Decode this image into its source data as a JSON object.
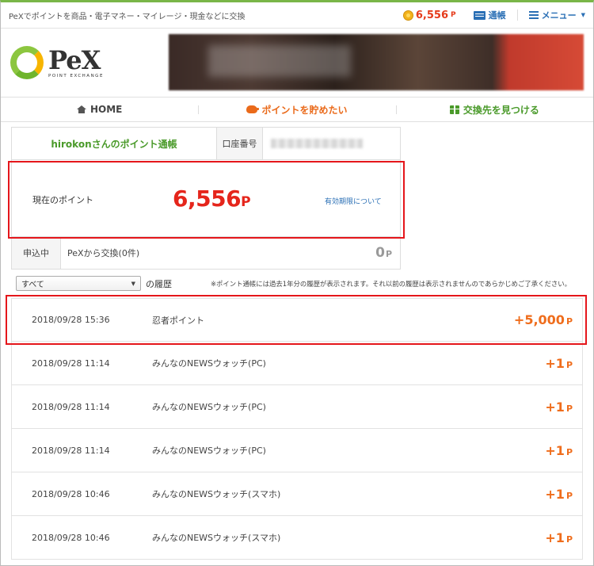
{
  "topbar": {
    "tagline": "PeXでポイントを商品・電子マネー・マイレージ・現金などに交換",
    "points": "6,556",
    "points_unit": "P",
    "passbook_link": "通帳",
    "menu_link": "メニュー"
  },
  "logo": {
    "main": "PeX",
    "sub": "POINT EXCHANGE"
  },
  "nav": {
    "home": "HOME",
    "save": "ポイントを貯めたい",
    "exchange": "交換先を見つける"
  },
  "passbook": {
    "owner": "hirokonさんのポイント通帳",
    "account_label": "口座番号",
    "current_label": "現在のポイント",
    "current_value": "6,556",
    "current_unit": "P",
    "expiry_link": "有効期限について",
    "pending_label": "申込中",
    "pending_desc": "PeXから交換(0件)",
    "pending_value": "0",
    "pending_unit": "P"
  },
  "filter": {
    "selected": "すべて",
    "suffix": "の履歴",
    "notice": "※ポイント通帳には過去1年分の履歴が表示されます。それ以前の履歴は表示されませんのであらかじめご了承ください。"
  },
  "history": [
    {
      "date": "2018/09/28 15:36",
      "desc": "忍者ポイント",
      "amount": "+5,000",
      "unit": "P"
    },
    {
      "date": "2018/09/28 11:14",
      "desc": "みんなのNEWSウォッチ(PC)",
      "amount": "+1",
      "unit": "P"
    },
    {
      "date": "2018/09/28 11:14",
      "desc": "みんなのNEWSウォッチ(PC)",
      "amount": "+1",
      "unit": "P"
    },
    {
      "date": "2018/09/28 11:14",
      "desc": "みんなのNEWSウォッチ(PC)",
      "amount": "+1",
      "unit": "P"
    },
    {
      "date": "2018/09/28 10:46",
      "desc": "みんなのNEWSウォッチ(スマホ)",
      "amount": "+1",
      "unit": "P"
    },
    {
      "date": "2018/09/28 10:46",
      "desc": "みんなのNEWSウォッチ(スマホ)",
      "amount": "+1",
      "unit": "P"
    }
  ],
  "colors": {
    "accent_green": "#4a9a2a",
    "points_red": "#e5251b",
    "amount_orange": "#ef6d1c",
    "link_blue": "#2a6fb5"
  }
}
